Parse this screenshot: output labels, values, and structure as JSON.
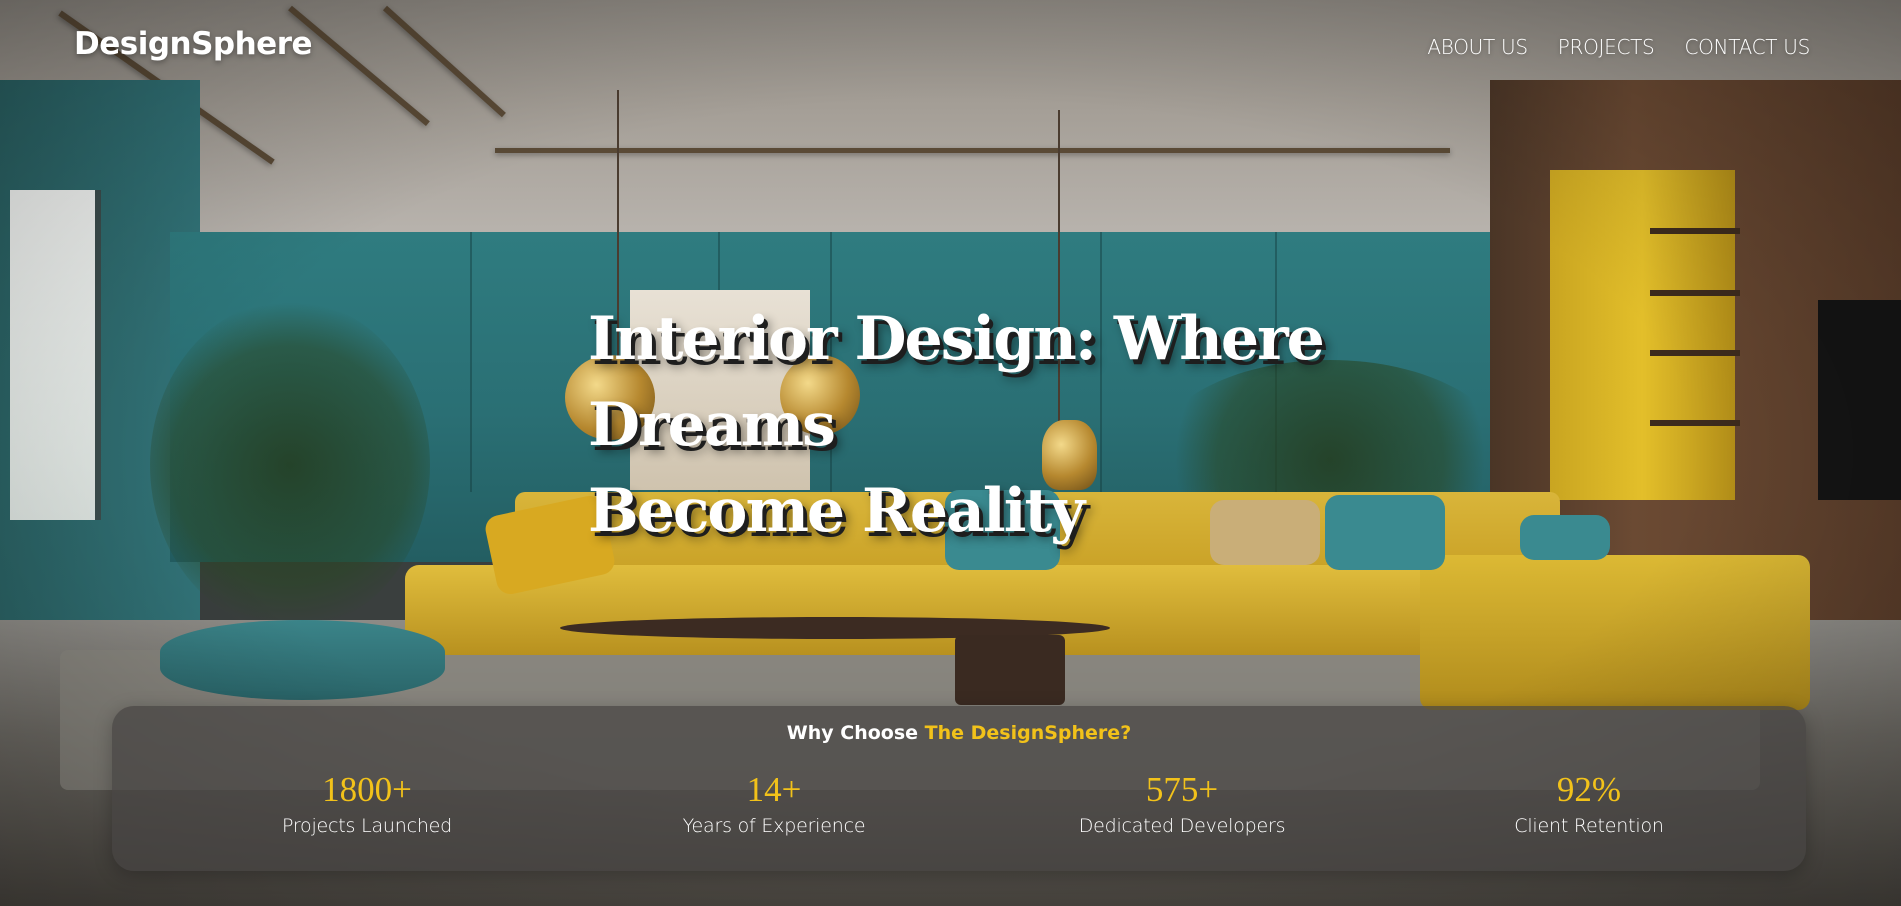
{
  "brand": {
    "name": "DesignSphere"
  },
  "nav": {
    "items": [
      {
        "label": "ABOUT US"
      },
      {
        "label": "PROJECTS"
      },
      {
        "label": "CONTACT US"
      }
    ]
  },
  "hero": {
    "headline_line1": "Interior Design: Where Dreams",
    "headline_line2": "Become Reality"
  },
  "stats": {
    "title_prefix": "Why Choose ",
    "title_highlight": "The DesignSphere?",
    "items": [
      {
        "value": "1800+",
        "label": "Projects Launched"
      },
      {
        "value": "14+",
        "label": "Years of Experience"
      },
      {
        "value": "575+",
        "label": "Dedicated Developers"
      },
      {
        "value": "92%",
        "label": "Client Retention"
      }
    ]
  },
  "colors": {
    "accent": "#f2c21a",
    "text": "#ffffff",
    "panel": "#464442"
  }
}
